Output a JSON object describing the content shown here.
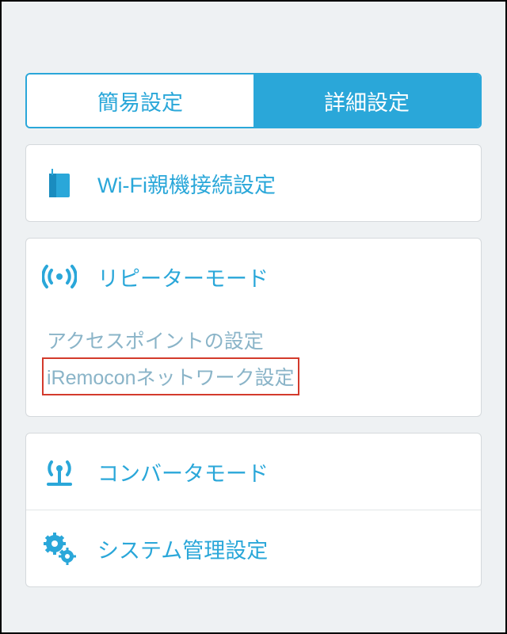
{
  "tabs": {
    "simple": "簡易設定",
    "advanced": "詳細設定"
  },
  "wifi_parent_label": "Wi-Fi親機接続設定",
  "repeater_label": "リピーターモード",
  "sub_items": {
    "access_point": "アクセスポイントの設定",
    "iremocon_network": "iRemoconネットワーク設定"
  },
  "converter_label": "コンバータモード",
  "system_label": "システム管理設定",
  "colors": {
    "accent": "#2aa7d9",
    "highlight_border": "#d33a2c"
  }
}
